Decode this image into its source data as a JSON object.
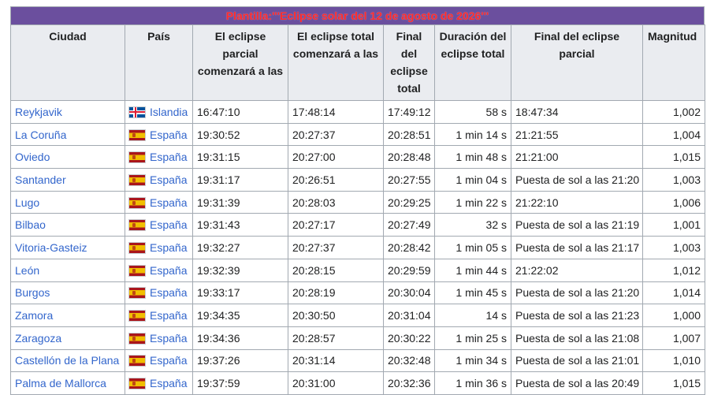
{
  "caption": "Plantilla:'''Eclipse solar del 12 de agosto de 2026'''",
  "headers": [
    "Ciudad",
    "País",
    "El eclipse parcial comenzará a las",
    "El eclipse total comenzará a las",
    "Final del eclipse total",
    "Duración del eclipse total",
    "Final del eclipse parcial",
    "Magnitud"
  ],
  "rows": [
    {
      "city": "Reykjavik",
      "country": "Islandia",
      "flag": "iceland-flag-icon",
      "partial_start": "16:47:10",
      "total_start": "17:48:14",
      "total_end": "17:49:12",
      "duration": "58 s",
      "partial_end": "18:47:34",
      "magnitude": "1,002"
    },
    {
      "city": "La Coruña",
      "country": "España",
      "flag": "spain-flag-icon",
      "partial_start": "19:30:52",
      "total_start": "20:27:37",
      "total_end": "20:28:51",
      "duration": "1 min 14 s",
      "partial_end": "21:21:55",
      "magnitude": "1,004"
    },
    {
      "city": "Oviedo",
      "country": "España",
      "flag": "spain-flag-icon",
      "partial_start": "19:31:15",
      "total_start": "20:27:00",
      "total_end": "20:28:48",
      "duration": "1 min 48 s",
      "partial_end": "21:21:00",
      "magnitude": "1,015"
    },
    {
      "city": "Santander",
      "country": "España",
      "flag": "spain-flag-icon",
      "partial_start": "19:31:17",
      "total_start": "20:26:51",
      "total_end": "20:27:55",
      "duration": "1 min 04 s",
      "partial_end": "Puesta de sol a las 21:20",
      "magnitude": "1,003"
    },
    {
      "city": "Lugo",
      "country": "España",
      "flag": "spain-flag-icon",
      "partial_start": "19:31:39",
      "total_start": "20:28:03",
      "total_end": "20:29:25",
      "duration": "1 min 22 s",
      "partial_end": "21:22:10",
      "magnitude": "1,006"
    },
    {
      "city": "Bilbao",
      "country": "España",
      "flag": "spain-flag-icon",
      "partial_start": "19:31:43",
      "total_start": "20:27:17",
      "total_end": "20:27:49",
      "duration": "32 s",
      "partial_end": "Puesta de sol a las 21:19",
      "magnitude": "1,001"
    },
    {
      "city": "Vitoria-Gasteiz",
      "country": "España",
      "flag": "spain-flag-icon",
      "partial_start": "19:32:27",
      "total_start": "20:27:37",
      "total_end": "20:28:42",
      "duration": "1 min 05 s",
      "partial_end": "Puesta de sol a las 21:17",
      "magnitude": "1,003"
    },
    {
      "city": "León",
      "country": "España",
      "flag": "spain-flag-icon",
      "partial_start": "19:32:39",
      "total_start": "20:28:15",
      "total_end": "20:29:59",
      "duration": "1 min 44 s",
      "partial_end": "21:22:02",
      "magnitude": "1,012"
    },
    {
      "city": "Burgos",
      "country": "España",
      "flag": "spain-flag-icon",
      "partial_start": "19:33:17",
      "total_start": "20:28:19",
      "total_end": "20:30:04",
      "duration": "1 min 45 s",
      "partial_end": "Puesta de sol a las 21:20",
      "magnitude": "1,014"
    },
    {
      "city": "Zamora",
      "country": "España",
      "flag": "spain-flag-icon",
      "partial_start": "19:34:35",
      "total_start": "20:30:50",
      "total_end": "20:31:04",
      "duration": "14 s",
      "partial_end": "Puesta de sol a las 21:23",
      "magnitude": "1,000"
    },
    {
      "city": "Zaragoza",
      "country": "España",
      "flag": "spain-flag-icon",
      "partial_start": "19:34:36",
      "total_start": "20:28:57",
      "total_end": "20:30:22",
      "duration": "1 min 25 s",
      "partial_end": "Puesta de sol a las 21:08",
      "magnitude": "1,007"
    },
    {
      "city": "Castellón de la Plana",
      "country": "España",
      "flag": "spain-flag-icon",
      "partial_start": "19:37:26",
      "total_start": "20:31:14",
      "total_end": "20:32:48",
      "duration": "1 min 34 s",
      "partial_end": "Puesta de sol a las 21:01",
      "magnitude": "1,010"
    },
    {
      "city": "Palma de Mallorca",
      "country": "España",
      "flag": "spain-flag-icon",
      "partial_start": "19:37:59",
      "total_start": "20:31:00",
      "total_end": "20:32:36",
      "duration": "1 min 36 s",
      "partial_end": "Puesta de sol a las 20:49",
      "magnitude": "1,015"
    }
  ],
  "colors": {
    "caption_bg": "#6b4f9e",
    "caption_text": "#ff2b2b",
    "header_bg": "#eaecf0",
    "link": "#3366cc",
    "border": "#a2a9b1"
  }
}
